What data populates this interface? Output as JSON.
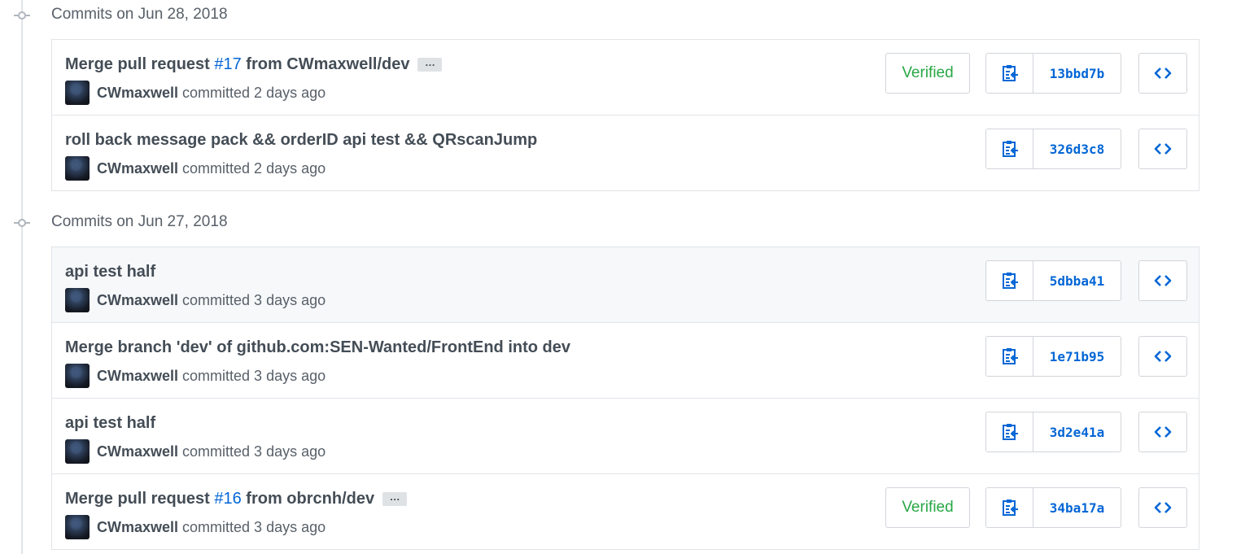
{
  "groups": [
    {
      "title": "Commits on Jun 28, 2018",
      "commits": [
        {
          "title_prefix": "Merge pull request ",
          "pr_link": "#17",
          "title_suffix": " from CWmaxwell/dev",
          "has_ellipsis": true,
          "author": "CWmaxwell",
          "time_text": "committed 2 days ago",
          "verified": "Verified",
          "sha": "13bbd7b"
        },
        {
          "title_prefix": "roll back message pack && orderID api test && QRscanJump",
          "pr_link": "",
          "title_suffix": "",
          "has_ellipsis": false,
          "author": "CWmaxwell",
          "time_text": "committed 2 days ago",
          "verified": "",
          "sha": "326d3c8"
        }
      ]
    },
    {
      "title": "Commits on Jun 27, 2018",
      "commits": [
        {
          "title_prefix": "api test half",
          "pr_link": "",
          "title_suffix": "",
          "has_ellipsis": false,
          "author": "CWmaxwell",
          "time_text": "committed 3 days ago",
          "verified": "",
          "sha": "5dbba41",
          "highlighted": true
        },
        {
          "title_prefix": "Merge branch 'dev' of github.com:SEN-Wanted/FrontEnd into dev",
          "pr_link": "",
          "title_suffix": "",
          "has_ellipsis": false,
          "author": "CWmaxwell",
          "time_text": "committed 3 days ago",
          "verified": "",
          "sha": "1e71b95"
        },
        {
          "title_prefix": "api test half",
          "pr_link": "",
          "title_suffix": "",
          "has_ellipsis": false,
          "author": "CWmaxwell",
          "time_text": "committed 3 days ago",
          "verified": "",
          "sha": "3d2e41a"
        },
        {
          "title_prefix": "Merge pull request ",
          "pr_link": "#16",
          "title_suffix": " from obrcnh/dev",
          "has_ellipsis": true,
          "author": "CWmaxwell",
          "time_text": "committed 3 days ago",
          "verified": "Verified",
          "sha": "34ba17a"
        }
      ]
    }
  ],
  "ellipsis_label": "…",
  "icons": {
    "group": "git-commit-icon",
    "copy": "clippy-icon",
    "browse": "code-icon"
  },
  "colors": {
    "link": "#0366d6",
    "verified": "#28a745",
    "border": "#e1e4e8",
    "highlight_bg": "#f6f8fa"
  }
}
